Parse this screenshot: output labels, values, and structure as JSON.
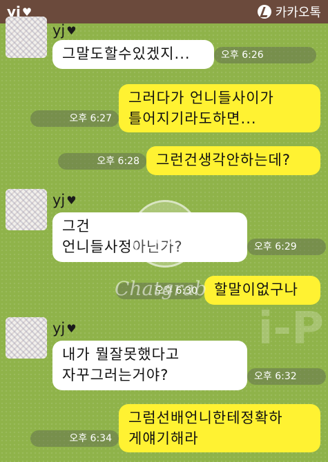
{
  "header": {
    "contact_name": "yj",
    "brand_label": "카카오톡"
  },
  "messages": [
    {
      "side": "in",
      "sender": "yj",
      "lines": [
        "그말도할수있겠지..."
      ],
      "time": "오후 6:26"
    },
    {
      "side": "out",
      "lines": [
        "그러다가 언니들사이가",
        "틀어지기라도하면..."
      ],
      "time": "오후 6:27"
    },
    {
      "side": "out",
      "lines": [
        "그런건생각안하는데?"
      ],
      "time": "오후 6:28"
    },
    {
      "side": "in",
      "sender": "yj",
      "lines": [
        "그건",
        "언니들사정아닌가?"
      ],
      "time": "오후 6:29"
    },
    {
      "side": "out",
      "lines": [
        "할말이없구나"
      ],
      "time": "오후 6:30"
    },
    {
      "side": "in",
      "sender": "yj",
      "lines": [
        "내가 뭘잘못했다고",
        "자꾸그러는거야?"
      ],
      "time": "오후 6:32"
    },
    {
      "side": "out",
      "lines": [
        "그럼선배언니한테정확하",
        "게얘기해라"
      ],
      "time": "오후 6:34"
    }
  ],
  "watermark": {
    "letter": "G",
    "text": "Chatgrab"
  },
  "background_deco": "i-P",
  "colors": {
    "header_bg": "#6b4a3c",
    "chat_bg": "#8fb34a",
    "incoming_bubble": "#ffffff",
    "outgoing_bubble": "#fff232"
  },
  "icons": {
    "header_heart": "heart-icon",
    "brand": "kakaotalk-logo-icon",
    "sender_heart": "heart-icon"
  }
}
